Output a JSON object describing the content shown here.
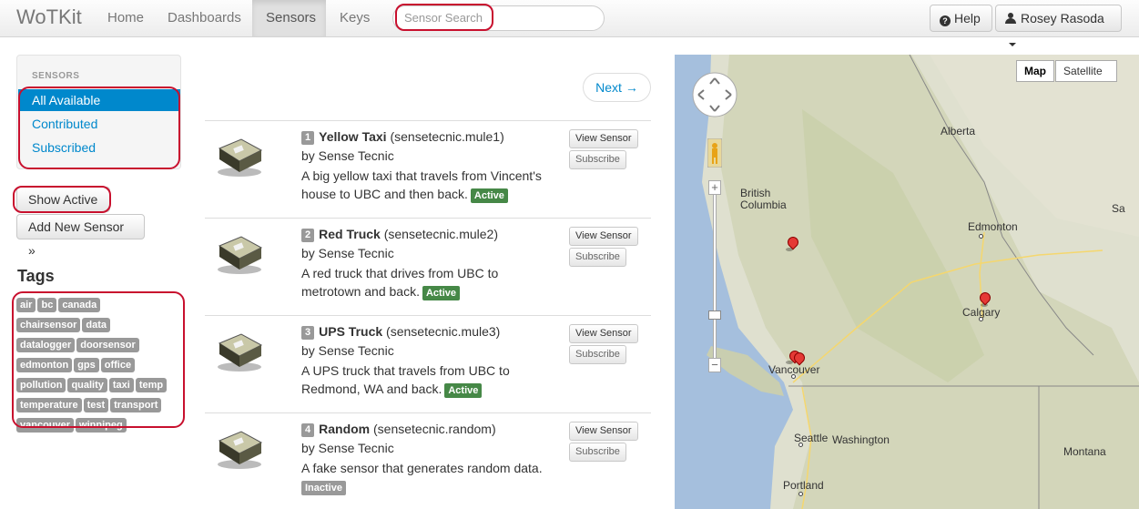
{
  "navbar": {
    "brand": "WoTKit",
    "items": [
      {
        "label": "Home",
        "active": false
      },
      {
        "label": "Dashboards",
        "active": false
      },
      {
        "label": "Sensors",
        "active": true
      },
      {
        "label": "Keys",
        "active": false
      }
    ],
    "search_placeholder": "Sensor Search",
    "help_label": "Help",
    "user_label": "Rosey Rasoda"
  },
  "sidebar": {
    "header": "SENSORS",
    "items": [
      {
        "label": "All Available",
        "active": true
      },
      {
        "label": "Contributed",
        "active": false
      },
      {
        "label": "Subscribed",
        "active": false
      }
    ],
    "show_active_label": "Show Active",
    "add_sensor_label": "Add New Sensor »",
    "tags_title": "Tags",
    "tags": [
      "air",
      "bc",
      "canada",
      "chairsensor",
      "data",
      "datalogger",
      "doorsensor",
      "edmonton",
      "gps",
      "office",
      "pollution",
      "quality",
      "taxi",
      "temp",
      "temperature",
      "test",
      "transport",
      "vancouver",
      "winnipeg"
    ]
  },
  "list": {
    "next_label": "Next →",
    "view_label": "View Sensor",
    "subscribe_label": "Subscribe",
    "sensors": [
      {
        "num": "1",
        "name": "Yellow Taxi",
        "id": "(sensetecnic.mule1)",
        "by": "by Sense Tecnic",
        "desc": "A big yellow taxi that travels from Vincent's house to UBC and then back.",
        "status": "Active"
      },
      {
        "num": "2",
        "name": "Red Truck",
        "id": "(sensetecnic.mule2)",
        "by": "by Sense Tecnic",
        "desc": "A red truck that drives from UBC to metrotown and back.",
        "status": "Active"
      },
      {
        "num": "3",
        "name": "UPS Truck",
        "id": "(sensetecnic.mule3)",
        "by": "by Sense Tecnic",
        "desc": "A UPS truck that travels from UBC to Redmond, WA and back.",
        "status": "Active"
      },
      {
        "num": "4",
        "name": "Random",
        "id": "(sensetecnic.random)",
        "by": "by Sense Tecnic",
        "desc": "A fake sensor that generates random data.",
        "status": "Inactive"
      }
    ]
  },
  "map": {
    "type_map": "Map",
    "type_satellite": "Satellite",
    "labels": {
      "alberta": "Alberta",
      "british_columbia": "British\nColumbia",
      "edmonton": "Edmonton",
      "calgary": "Calgary",
      "vancouver": "Vancouver",
      "seattle": "Seattle",
      "washington": "Washington",
      "montana": "Montana",
      "portland": "Portland",
      "edge_sa": "Sa"
    }
  }
}
